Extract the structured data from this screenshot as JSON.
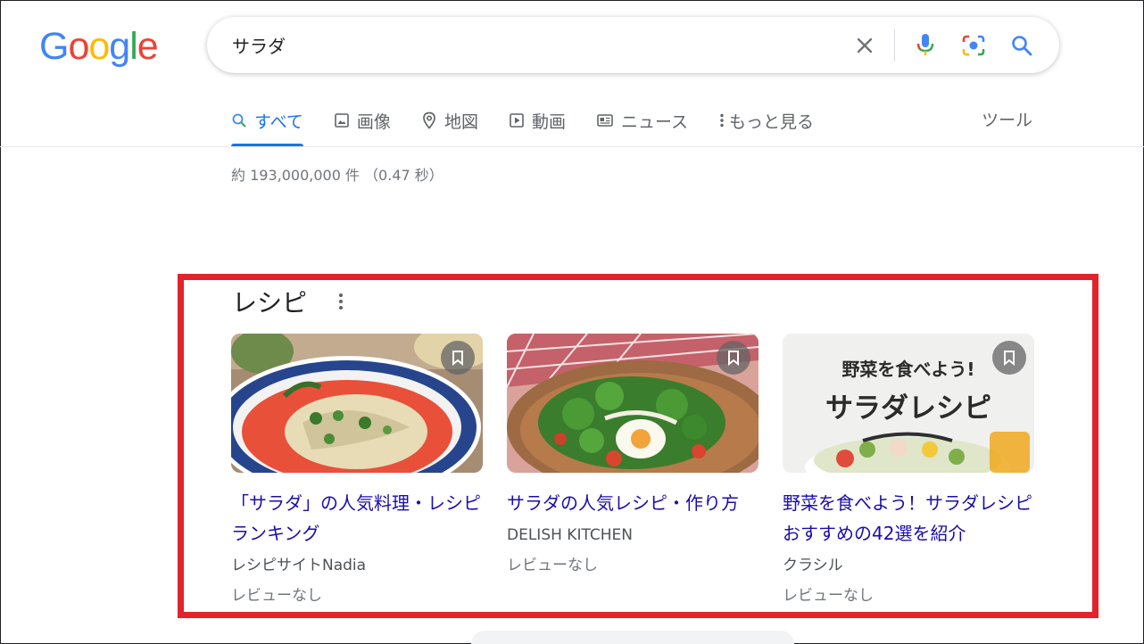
{
  "logo": {
    "letters": [
      "G",
      "o",
      "o",
      "g",
      "l",
      "e"
    ]
  },
  "search": {
    "query": "サラダ"
  },
  "icons": {
    "clear": "close-icon",
    "mic": "mic-icon",
    "lens": "camera-lens-icon",
    "search": "search-icon"
  },
  "tabs": [
    {
      "label": "すべて",
      "icon": "search-icon",
      "active": true
    },
    {
      "label": "画像",
      "icon": "image-icon"
    },
    {
      "label": "地図",
      "icon": "map-pin-icon"
    },
    {
      "label": "動画",
      "icon": "play-icon"
    },
    {
      "label": "ニュース",
      "icon": "news-icon"
    },
    {
      "label": "もっと見る",
      "icon": "more-vert-icon"
    }
  ],
  "tools": "ツール",
  "result_stats": "約 193,000,000 件 （0.47 秒）",
  "recipes": {
    "heading": "レシピ",
    "cards": [
      {
        "title": "「サラダ」の人気料理・レシピランキング",
        "source": "レシピサイトNadia",
        "review": "レビューなし"
      },
      {
        "title": "サラダの人気レシピ・作り方",
        "source": "DELISH KITCHEN",
        "review": "レビューなし"
      },
      {
        "title": "野菜を食べよう！サラダレシピ おすすめの42選を紹介",
        "source": "クラシル",
        "review": "レビューなし",
        "image_text": {
          "line1": "野菜を食べよう!",
          "line2": "サラダレシピ"
        }
      }
    ]
  },
  "colors": {
    "accent": "#1a73e8",
    "link": "#1a0dab",
    "highlight": "#e2232c"
  }
}
